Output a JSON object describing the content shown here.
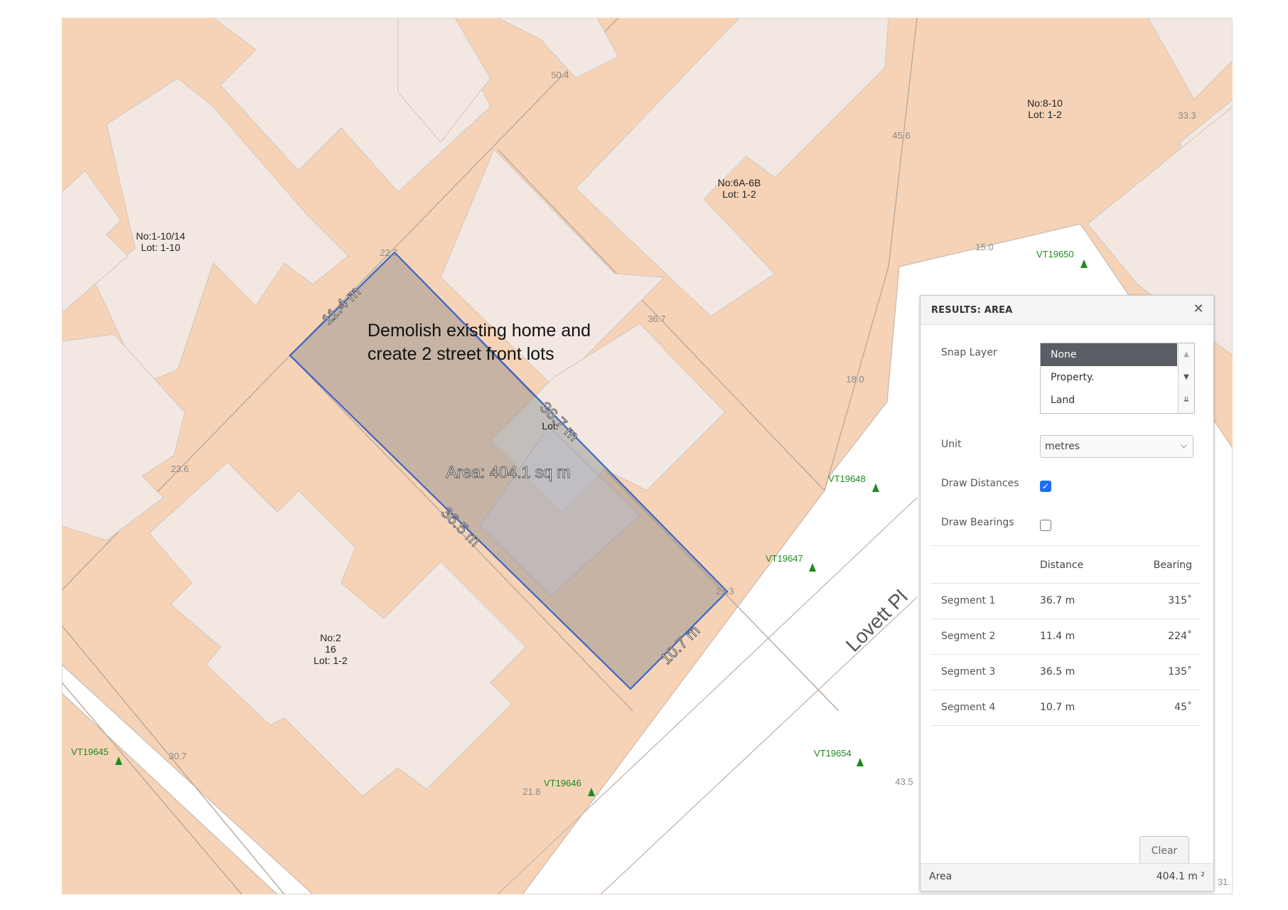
{
  "map": {
    "parcel_labels": {
      "p1": [
        "No:1-10/14",
        "Lot: 1-10"
      ],
      "p2": [
        "No:6A-6B",
        "Lot: 1-2"
      ],
      "p3": [
        "No:8-10",
        "Lot: 1-2"
      ],
      "p4": [
        "No:2",
        "16",
        "Lot: 1-2"
      ],
      "p5": [
        "Lot:"
      ]
    },
    "dimension_labels": [
      "50.4",
      "45.6",
      "33.3",
      "15.0",
      "22.7",
      "36.7",
      "18.0",
      "23.6",
      "21.3",
      "30.7",
      "21.8",
      "43.5",
      "31."
    ],
    "survey_marks": [
      "VT19650",
      "VT19648",
      "VT19647",
      "VT19645",
      "VT19646",
      "VT19654"
    ],
    "street_name": "Lovett Pl",
    "measurement": {
      "edge_labels": [
        "11.4 m",
        "36.7 m",
        "36.5 m",
        "10.7 m"
      ],
      "area_label": "Area: 404.1 sq m"
    },
    "annotation": [
      "Demolish existing home and",
      "create 2 street front lots"
    ]
  },
  "panel": {
    "title": "RESULTS: AREA",
    "close_icon": "close-icon",
    "snap_layer": {
      "label": "Snap Layer",
      "options": [
        "None",
        "Property.",
        "Land"
      ],
      "selected": "None"
    },
    "unit": {
      "label": "Unit",
      "value": "metres"
    },
    "draw_distances": {
      "label": "Draw Distances",
      "checked": true
    },
    "draw_bearings": {
      "label": "Draw Bearings",
      "checked": false
    },
    "table": {
      "headers": [
        "Distance",
        "Bearing"
      ],
      "rows": [
        {
          "segment": "Segment 1",
          "distance": "36.7 m",
          "bearing": "315˚"
        },
        {
          "segment": "Segment 2",
          "distance": "11.4 m",
          "bearing": "224˚"
        },
        {
          "segment": "Segment 3",
          "distance": "36.5 m",
          "bearing": "135˚"
        },
        {
          "segment": "Segment 4",
          "distance": "10.7 m",
          "bearing": "45˚"
        }
      ]
    },
    "clear_label": "Clear",
    "footer": {
      "label": "Area",
      "value": "404.1 m ²"
    }
  },
  "colors": {
    "lot_fill": "#f6d3b7",
    "building_fill": "#f2e8e1",
    "road_fill": "#ffffff",
    "measure_stroke": "#3a66c4",
    "survey_green": "#1f8a1f"
  }
}
